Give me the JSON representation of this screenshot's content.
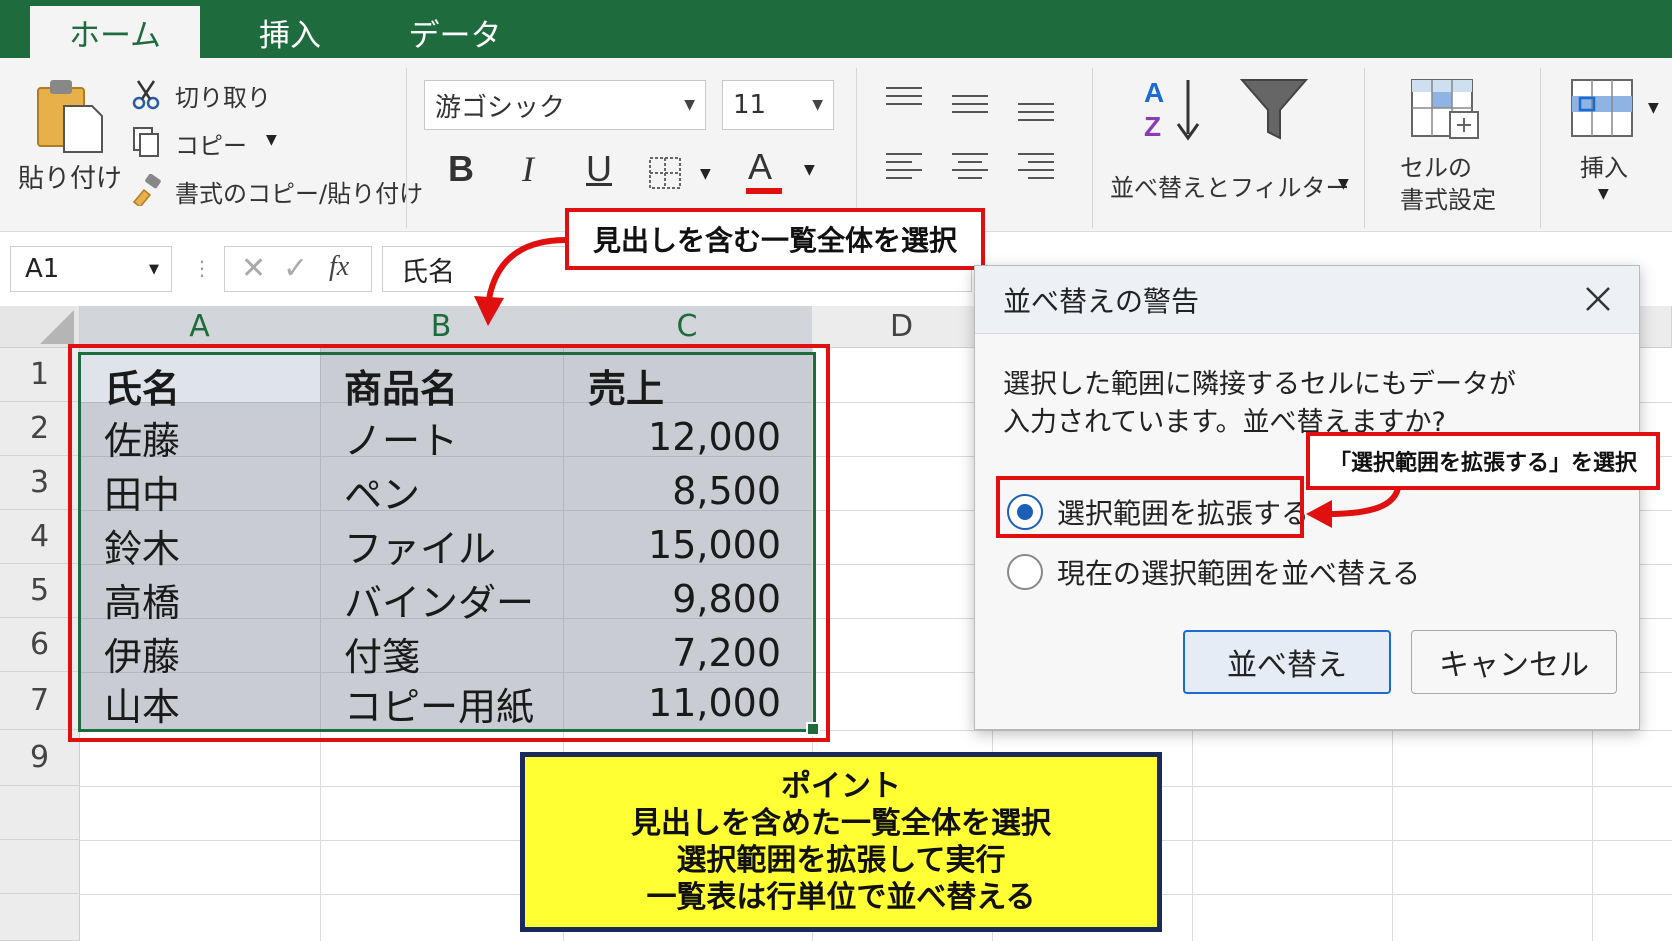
{
  "tabs": {
    "home": "ホーム",
    "insert": "挿入",
    "data": "データ"
  },
  "ribbon": {
    "clipboard": {
      "paste": "貼り付け",
      "cut": "切り取り",
      "copy": "コピー",
      "format_painter": "書式のコピー/貼り付け"
    },
    "font": {
      "name": "游ゴシック",
      "size": "11",
      "bold": "B",
      "italic": "I",
      "underline": "U",
      "font_color": "A"
    },
    "sort_filter": "並べ替えとフィルター",
    "cell_format_line1": "セルの",
    "cell_format_line2": "書式設定",
    "insert": "挿入"
  },
  "formula_bar": {
    "name_box": "A1",
    "fx": "fx",
    "content": "氏名"
  },
  "columns": [
    "A",
    "B",
    "C",
    "D"
  ],
  "rows": [
    "1",
    "2",
    "3",
    "4",
    "5",
    "6",
    "7",
    "9"
  ],
  "table": {
    "header": [
      "氏名",
      "商品名",
      "売上"
    ],
    "rows": [
      [
        "佐藤",
        "ノート",
        "12,000"
      ],
      [
        "田中",
        "ペン",
        "8,500"
      ],
      [
        "鈴木",
        "ファイル",
        "15,000"
      ],
      [
        "高橋",
        "バインダー",
        "9,800"
      ],
      [
        "伊藤",
        "付箋",
        "7,200"
      ],
      [
        "山本",
        "コピー用紙",
        "11,000"
      ]
    ]
  },
  "annotations": {
    "select_all": "見出しを含む一覧全体を選択",
    "select_expand": "「選択範囲を拡張する」を選択"
  },
  "dialog": {
    "title": "並べ替えの警告",
    "message_line1": "選択した範囲に隣接するセルにもデータが",
    "message_line2": "入力されています。並べ替えますか?",
    "option_expand": "選択範囲を拡張する",
    "option_current": "現在の選択範囲を並べ替える",
    "sort_button": "並べ替え",
    "cancel_button": "キャンセル"
  },
  "point": {
    "title": "ポイント",
    "line1": "見出しを含めた一覧全体を選択",
    "line2": "選択範囲を拡張して実行",
    "line3": "一覧表は行単位で並べ替える"
  },
  "colors": {
    "excel_green": "#1e6b3e",
    "annotation_red": "#e01010",
    "point_yellow": "#ffff33",
    "point_border": "#1a2a5c",
    "radio_blue": "#1b5fb8"
  }
}
